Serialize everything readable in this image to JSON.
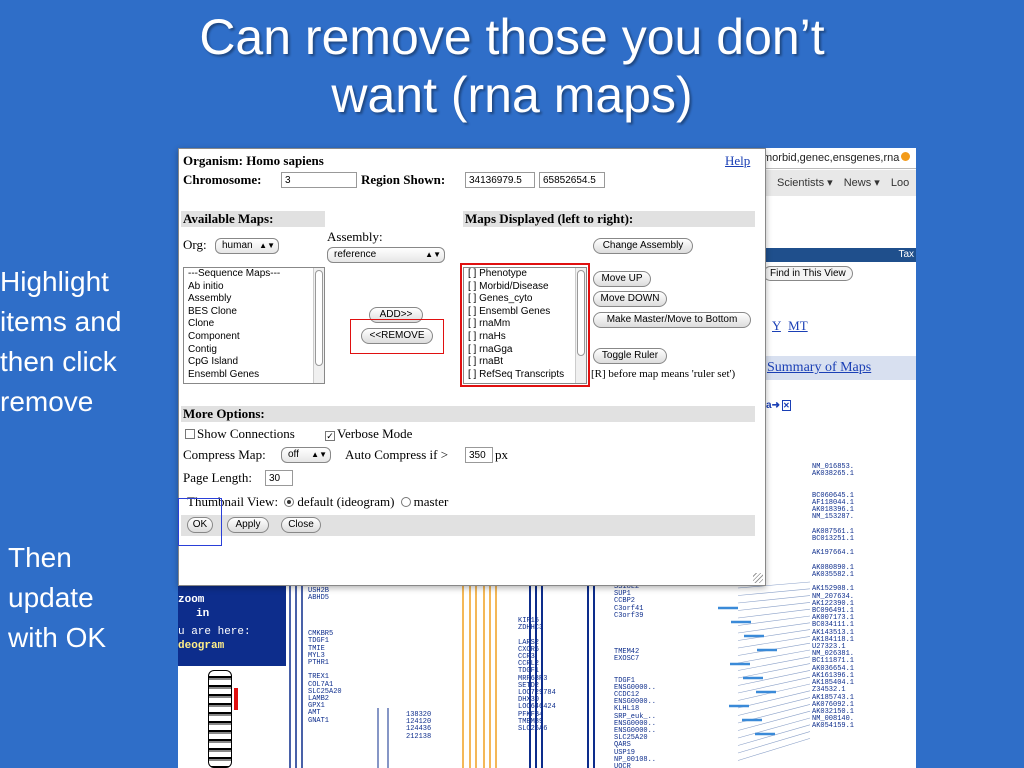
{
  "slide": {
    "title_line1": "Can remove those you don’t",
    "title_line2": "want (rna maps)",
    "left_note1": [
      "Highlight",
      "items and",
      "then click",
      "remove"
    ],
    "left_note2": [
      "Then",
      "update",
      "with OK"
    ]
  },
  "background_page": {
    "url_fragment": "morbid,genec,ensgenes,rna",
    "nav_items": [
      "Scientists ▾",
      "News ▾",
      "Loo"
    ],
    "bar_text": "Tax",
    "find_button": "Find in This View",
    "links": [
      "Y",
      "MT"
    ],
    "summary_link": "Summary of Maps",
    "zoom_label1": "zoom",
    "zoom_label2": "in",
    "you_are_here": "u are here:",
    "ideogram_label": "deogram",
    "gene_col1": [
      "USH2B",
      "ABHD5",
      "",
      "",
      "",
      "",
      "CMKBR5",
      "TDGF1",
      "TMIE",
      "MYL3",
      "PTHR1",
      "",
      "TREX1",
      "COL7A1",
      "SLC25A20",
      "LAMB2",
      "GPX1",
      "AMT",
      "GNAT1"
    ],
    "gene_col2": [
      "138320",
      "124120",
      "124436",
      "212138"
    ],
    "gene_col3": [
      "KIF15",
      "ZDHHC3",
      "",
      "LARS2",
      "CXCR6",
      "CCR3",
      "CCRL2",
      "TDGF1",
      "MRP63P3",
      "SETD2",
      "LOC729784",
      "DHX30",
      "LOC646424",
      "PFKFB4",
      "TMEM89",
      "SLC26A6"
    ],
    "gene_col4": [
      "SS18L2",
      "SUP1",
      "CCBP2",
      "C3orf41",
      "C3orf39",
      "",
      "",
      "",
      "",
      "TMEM42",
      "EXOSC7",
      "",
      "",
      "TDGF1",
      "ENSG0000..",
      "CCDC12",
      "ENSG0000..",
      "KLHL18",
      "SRP_euk_..",
      "ENSG0000..",
      "ENSG0000..",
      "SLC25A20",
      "QARS",
      "USP19",
      "NP_00108..",
      "UQCR"
    ],
    "gene_col5": [
      "NM_016853.",
      "AK038265.1",
      "",
      "",
      "BC060645.1",
      "AF118044.1",
      "AK018396.1",
      "NM_153287.",
      "",
      "AK087561.1",
      "BC013251.1",
      "",
      "AK197664.1",
      "",
      "AK080890.1",
      "AK035582.1",
      "",
      "AK152908.1",
      "NM_207634.",
      "AK122390.1",
      "BC096491.1",
      "AK007173.1",
      "BC034111.1",
      "AK143513.1",
      "AK184118.1",
      "U27323.1",
      "NM_026381.",
      "BC111871.1",
      "AK036654.1",
      "AK161396.1",
      "AK185404.1",
      "Z34532.1",
      "AK185743.1",
      "AK076092.1",
      "AK032150.1",
      "NM_008140.",
      "AK054159.1"
    ]
  },
  "dialog": {
    "organism": "Organism: Homo sapiens",
    "help": "Help",
    "chromosome_label": "Chromosome:",
    "chromosome_value": "3",
    "region_label": "Region Shown:",
    "region_start": "34136979.5",
    "region_end": "65852654.5",
    "available_maps_header": "Available Maps:",
    "maps_displayed_header": "Maps Displayed (left to right):",
    "org_label": "Org:",
    "org_value": "human",
    "assembly_label": "Assembly:",
    "assembly_value": "reference",
    "change_assembly": "Change Assembly",
    "available_maps": [
      "---Sequence Maps---",
      "Ab initio",
      "Assembly",
      "BES Clone",
      "Clone",
      "Component",
      "Contig",
      "CpG Island",
      "Ensembl Genes"
    ],
    "displayed_maps": [
      "[ ] Phenotype",
      "[ ] Morbid/Disease",
      "[ ] Genes_cyto",
      "[ ] Ensembl Genes",
      "[ ] rnaMm",
      "[ ] rnaHs",
      "[ ] rnaGga",
      "[ ] rnaBt",
      "[ ] RefSeq Transcripts"
    ],
    "add_button": "ADD>>",
    "remove_button": "<<REMOVE",
    "move_up": "Move UP",
    "move_down": "Move DOWN",
    "make_master": "Make Master/Move to Bottom",
    "toggle_ruler": "Toggle Ruler",
    "ruler_note": "[R] before map means 'ruler set')",
    "more_options_header": "More Options:",
    "show_connections": "Show Connections",
    "verbose_mode": "Verbose Mode",
    "verbose_check": "✓",
    "compress_label": "Compress Map:",
    "compress_value": "off",
    "auto_compress_label": "Auto Compress if >",
    "auto_compress_value": "350",
    "px_label": "px",
    "page_length_label": "Page Length:",
    "page_length_value": "30",
    "thumbnail_label": "Thumbnail View:",
    "thumb_default": "default (ideogram)",
    "thumb_master": "master",
    "ok": "OK",
    "apply": "Apply",
    "close": "Close"
  },
  "colors": {
    "slide_bg": "#2f6ec8",
    "highlight_red": "#e01010",
    "highlight_blue": "#2a3fd8",
    "map_blue": "#0d2d8c",
    "map_orange": "#f0a020"
  }
}
